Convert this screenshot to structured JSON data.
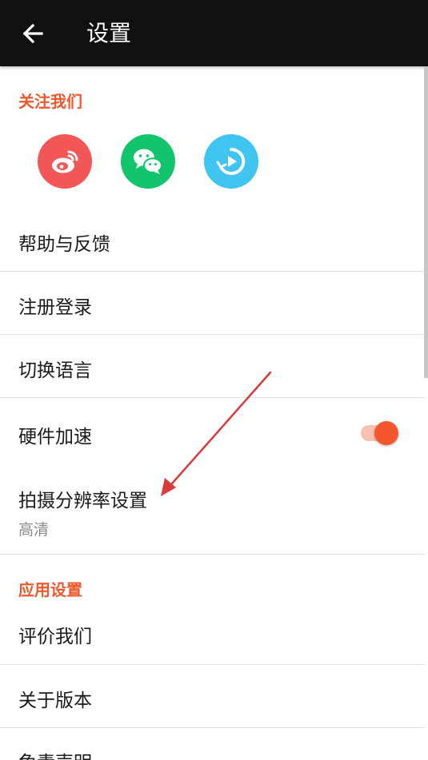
{
  "toolbar": {
    "title": "设置",
    "back_icon": "arrow-left-icon"
  },
  "follow_section": {
    "title": "关注我们",
    "accounts": [
      {
        "name": "weibo",
        "icon": "weibo-icon",
        "color": "#f25656"
      },
      {
        "name": "wechat",
        "icon": "wechat-icon",
        "color": "#12c46c"
      },
      {
        "name": "video",
        "icon": "video-play-icon",
        "color": "#3fc5f0"
      }
    ]
  },
  "items": {
    "help": "帮助与反馈",
    "register": "注册登录",
    "language": "切换语言",
    "hardware": "硬件加速",
    "resolution": "拍摄分辨率设置",
    "resolution_value": "高清"
  },
  "hardware_toggle": {
    "on": true
  },
  "app_section": {
    "title": "应用设置",
    "rate": "评价我们",
    "version": "关于版本",
    "disclaimer": "免责声明"
  },
  "colors": {
    "accent": "#f0582b",
    "toolbar_bg": "#111111",
    "annotation_arrow": "#d93a3a"
  }
}
